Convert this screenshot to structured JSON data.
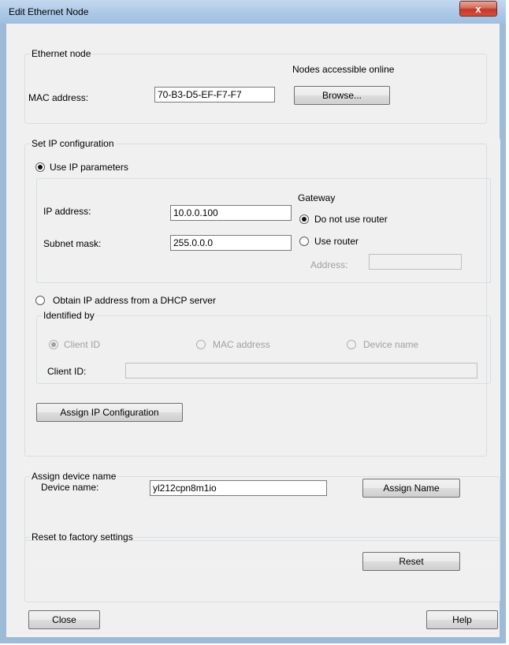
{
  "window": {
    "title": "Edit Ethernet Node",
    "close_glyph": "x"
  },
  "ethernet_node": {
    "legend": "Ethernet node",
    "mac_label": "MAC address:",
    "mac_value": "70-B3-D5-EF-F7-F7",
    "nodes_online_label": "Nodes accessible online",
    "browse_label": "Browse..."
  },
  "ip_config": {
    "legend": "Set IP configuration",
    "use_ip_params_label": "Use IP parameters",
    "ip_address_label": "IP address:",
    "ip_address_value": "10.0.0.100",
    "subnet_mask_label": "Subnet mask:",
    "subnet_mask_value": "255.0.0.0",
    "gateway_label": "Gateway",
    "do_not_use_router_label": "Do not use router",
    "use_router_label": "Use router",
    "router_address_label": "Address:",
    "router_address_value": "",
    "dhcp_label": "Obtain IP address from a DHCP server",
    "identified_by_legend": "Identified by",
    "client_id_option": "Client ID",
    "mac_address_option": "MAC address",
    "device_name_option": "Device name",
    "client_id_label": "Client ID:",
    "client_id_value": "",
    "assign_ip_label": "Assign IP Configuration"
  },
  "device_name": {
    "legend": "Assign device name",
    "label": "Device name:",
    "value": "yl212cpn8m1io",
    "assign_label": "Assign Name"
  },
  "reset": {
    "legend": "Reset to factory settings",
    "button_label": "Reset"
  },
  "footer": {
    "close_label": "Close",
    "help_label": "Help"
  }
}
